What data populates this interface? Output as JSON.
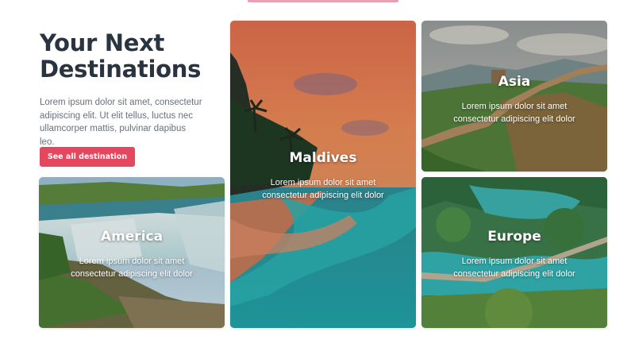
{
  "hero": {
    "title_line1": "Your Next",
    "title_line2": "Destinations",
    "description": "Lorem ipsum dolor sit amet, consectetur adipiscing elit. Ut elit tellus, luctus nec ullamcorper mattis, pulvinar dapibus leo.",
    "cta_label": "See all destination"
  },
  "cards": {
    "america": {
      "name": "America",
      "text": "Lorem ipsum dolor sit amet consectetur adipiscing elit dolor"
    },
    "maldives": {
      "name": "Maldives",
      "text": "Lorem ipsum dolor sit amet consectetur adipiscing elit dolor"
    },
    "asia": {
      "name": "Asia",
      "text": "Lorem ipsum dolor sit amet consectetur adipiscing elit dolor"
    },
    "europe": {
      "name": "Europe",
      "text": "Lorem ipsum dolor sit amet consectetur adipiscing elit dolor"
    }
  },
  "colors": {
    "accent": "#e5475f",
    "heading": "#2a3340",
    "body_text": "#69707c"
  }
}
